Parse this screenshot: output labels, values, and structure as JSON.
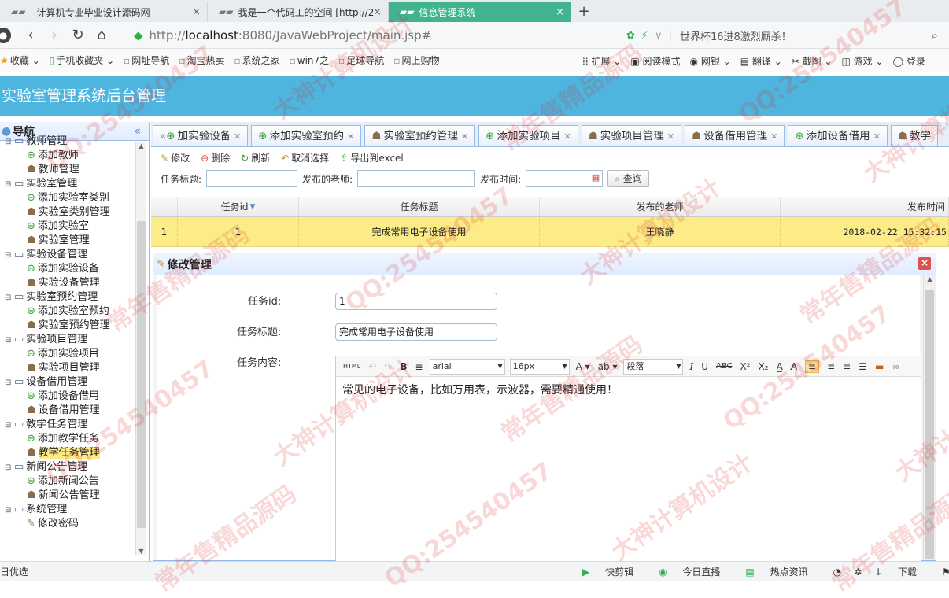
{
  "browser": {
    "tabs": [
      {
        "label": "- 计算机专业毕业设计源码网",
        "active": false
      },
      {
        "label": "我是一个代码工的空间 [http://2",
        "active": false
      },
      {
        "label": "信息管理系统",
        "active": true
      }
    ],
    "new_tab": "+",
    "url_prefix": "http://",
    "url_host": "localhost",
    "url_rest": ":8080/JavaWebProject/main.jsp#",
    "news_text": "世界杯16进8激烈厮杀！",
    "bookmarks": [
      "收藏",
      "手机收藏夹",
      "网址导航",
      "淘宝热卖",
      "系统之家",
      "win7之",
      "足球导航",
      "网上购物"
    ],
    "bookmarks_right": [
      "扩展",
      "阅读模式",
      "网银",
      "翻译",
      "截图",
      "游戏",
      "登录"
    ]
  },
  "app": {
    "title": "实验室管理系统后台管理"
  },
  "sidebar": {
    "title": "导航",
    "collapse": "«",
    "tree": [
      {
        "label": "教师管理",
        "type": "parent"
      },
      {
        "label": "添加教师",
        "type": "add"
      },
      {
        "label": "教师管理",
        "type": "manage"
      },
      {
        "label": "实验室管理",
        "type": "parent"
      },
      {
        "label": "添加实验室类别",
        "type": "add"
      },
      {
        "label": "实验室类别管理",
        "type": "manage"
      },
      {
        "label": "添加实验室",
        "type": "add"
      },
      {
        "label": "实验室管理",
        "type": "manage"
      },
      {
        "label": "实验设备管理",
        "type": "parent"
      },
      {
        "label": "添加实验设备",
        "type": "add"
      },
      {
        "label": "实验设备管理",
        "type": "manage"
      },
      {
        "label": "实验室预约管理",
        "type": "parent"
      },
      {
        "label": "添加实验室预约",
        "type": "add"
      },
      {
        "label": "实验室预约管理",
        "type": "manage"
      },
      {
        "label": "实验项目管理",
        "type": "parent"
      },
      {
        "label": "添加实验项目",
        "type": "add"
      },
      {
        "label": "实验项目管理",
        "type": "manage"
      },
      {
        "label": "设备借用管理",
        "type": "parent"
      },
      {
        "label": "添加设备借用",
        "type": "add"
      },
      {
        "label": "设备借用管理",
        "type": "manage"
      },
      {
        "label": "教学任务管理",
        "type": "parent"
      },
      {
        "label": "添加教学任务",
        "type": "add"
      },
      {
        "label": "教学任务管理",
        "type": "manage",
        "selected": true
      },
      {
        "label": "新闻公告管理",
        "type": "parent"
      },
      {
        "label": "添加新闻公告",
        "type": "add"
      },
      {
        "label": "新闻公告管理",
        "type": "manage"
      },
      {
        "label": "系统管理",
        "type": "parent"
      },
      {
        "label": "修改密码",
        "type": "edit"
      }
    ]
  },
  "panel_tabs": [
    {
      "label": "加实验设备",
      "icon": "add",
      "scroll": "«"
    },
    {
      "label": "添加实验室预约",
      "icon": "add"
    },
    {
      "label": "实验室预约管理",
      "icon": "person"
    },
    {
      "label": "添加实验项目",
      "icon": "add"
    },
    {
      "label": "实验项目管理",
      "icon": "person"
    },
    {
      "label": "设备借用管理",
      "icon": "person"
    },
    {
      "label": "添加设备借用",
      "icon": "add"
    },
    {
      "label": "教学",
      "icon": "person",
      "noclose": true
    }
  ],
  "toolbar": {
    "edit": "修改",
    "delete": "删除",
    "refresh": "刷新",
    "cancel": "取消选择",
    "export": "导出到excel"
  },
  "search": {
    "title_label": "任务标题:",
    "teacher_label": "发布的老师:",
    "time_label": "发布时间:",
    "query": "查询"
  },
  "grid": {
    "headers": [
      "任务id",
      "任务标题",
      "发布的老师",
      "发布时间"
    ],
    "rows": [
      {
        "index": "1",
        "id": "1",
        "title": "完成常用电子设备使用",
        "teacher": "王晓静",
        "time": "2018-02-22 15:32:15"
      }
    ]
  },
  "dialog": {
    "title": "修改管理",
    "close": "×",
    "id_label": "任务id:",
    "id_value": "1",
    "title_label": "任务标题:",
    "title_value": "完成常用电子设备使用",
    "content_label": "任务内容:",
    "editor": {
      "html": "HTML",
      "font": "arial",
      "size": "16px",
      "format": "段落",
      "content": "常见的电子设备，比如万用表，示波器，需要精通使用！"
    }
  },
  "statusbar": {
    "left": "日优选",
    "right": [
      "快剪辑",
      "今日直播",
      "热点资讯",
      "下载"
    ]
  },
  "watermarks": [
    "QQ:254540457",
    "大神计算机设计",
    "常年售精品源码"
  ]
}
